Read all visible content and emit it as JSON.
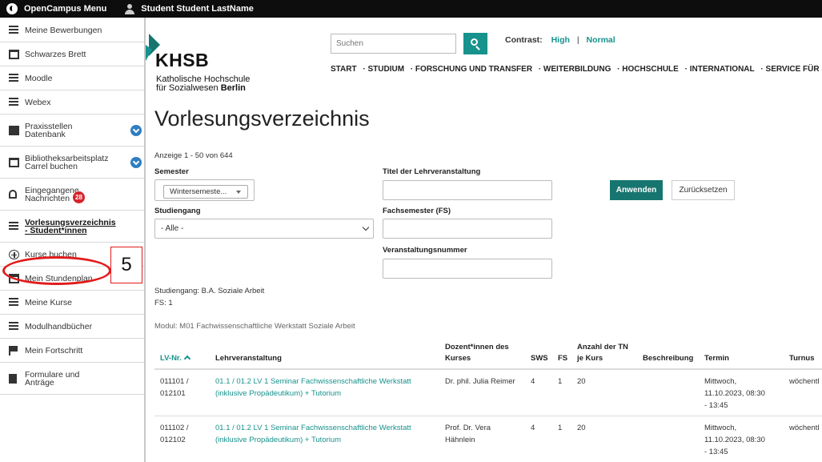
{
  "topbar": {
    "menu_label": "OpenCampus Menu",
    "user_label": "Student Student LastName"
  },
  "sidebar": {
    "items": [
      {
        "label": "Meine Bewerbungen",
        "icon": "list-icon"
      },
      {
        "label": "Schwarzes Brett",
        "icon": "board-icon"
      },
      {
        "label": "Moodle",
        "icon": "list-icon"
      },
      {
        "label": "Webex",
        "icon": "list-icon"
      },
      {
        "label": "Praxisstellen\nDatenbank",
        "icon": "building-icon",
        "expandable": true
      },
      {
        "label": "Bibliotheksarbeitsplatz\nCarrel buchen",
        "icon": "monitor-icon",
        "expandable": true
      },
      {
        "label": "Eingegangene\nNachrichten",
        "icon": "bell-icon",
        "badge": "28"
      },
      {
        "label": "Vorlesungsverzeichnis\n- Student*innen",
        "icon": "list-icon",
        "active": true
      },
      {
        "label": "Kurse buchen",
        "icon": "plus-circle-icon"
      },
      {
        "label": "Mein Stundenplan",
        "icon": "calendar-icon"
      },
      {
        "label": "Meine Kurse",
        "icon": "bulleted-list-icon"
      },
      {
        "label": "Modulhandbücher",
        "icon": "list-icon"
      },
      {
        "label": "Mein Fortschritt",
        "icon": "flag-icon"
      },
      {
        "label": "Formulare und\nAnträge",
        "icon": "document-icon"
      }
    ]
  },
  "annotation": {
    "step_number": "5",
    "color": "#e21b1b"
  },
  "header": {
    "logo_text": "KHSB",
    "logo_sub_line1": "Katholische Hochschule",
    "logo_sub_line2_a": "für Sozialwesen ",
    "logo_sub_line2_b": "Berlin",
    "search_placeholder": "Suchen",
    "contrast_label": "Contrast:",
    "contrast_high": "High",
    "contrast_sep": "|",
    "contrast_normal": "Normal",
    "nav": [
      "START",
      "· STUDIUM",
      "· FORSCHUNG UND TRANSFER",
      "· WEITERBILDUNG",
      "· HOCHSCHULE",
      "· INTERNATIONAL",
      "· SERVICE FÜR STUDIERE"
    ]
  },
  "page": {
    "title": "Vorlesungsverzeichnis",
    "count_text": "Anzeige 1 - 50 von 644"
  },
  "filters": {
    "semester_label": "Semester",
    "semester_value": "Wintersemeste...",
    "studiengang_label": "Studiengang",
    "studiengang_value": "- Alle -",
    "titel_label": "Titel der Lehrveranstaltung",
    "titel_value": "",
    "fachsemester_label": "Fachsemester (FS)",
    "fachsemester_value": "",
    "nummer_label": "Veranstaltungsnummer",
    "nummer_value": "",
    "apply_label": "Anwenden",
    "reset_label": "Zurücksetzen"
  },
  "summary": {
    "studiengang": "Studiengang: B.A. Soziale Arbeit",
    "fs": "FS: 1",
    "modul": "Modul: M01 Fachwissenschaftliche Werkstatt Soziale Arbeit"
  },
  "table": {
    "headers": {
      "lvnr": "LV-Nr.",
      "lehrveranstaltung": "Lehrveranstaltung",
      "dozent_1": "Dozent*innen des",
      "dozent_2": "Kurses",
      "sws": "SWS",
      "fs": "FS",
      "tn_1": "Anzahl der TN",
      "tn_2": "je Kurs",
      "beschreibung": "Beschreibung",
      "termin": "Termin",
      "turnus": "Turnus"
    },
    "rows": [
      {
        "lvnr_1": "011101 /",
        "lvnr_2": "012101",
        "title_1": "01.1 / 01.2 LV 1 Seminar Fachwissenschaftliche Werkstatt",
        "title_2": "(inklusive Propädeutikum) + Tutorium",
        "dozent_1": "Dr. phil. Julia Reimer",
        "dozent_2": "",
        "sws": "4",
        "fs": "1",
        "tn": "20",
        "termin_1": "Mittwoch,",
        "termin_2": "11.10.2023, 08:30",
        "termin_3": "- 13:45",
        "turnus": "wöchentl"
      },
      {
        "lvnr_1": "011102 /",
        "lvnr_2": "012102",
        "title_1": "01.1 / 01.2 LV 1 Seminar Fachwissenschaftliche Werkstatt",
        "title_2": "(inklusive Propädeutikum) + Tutorium",
        "dozent_1": "Prof. Dr. Vera",
        "dozent_2": "Hähnlein",
        "sws": "4",
        "fs": "1",
        "tn": "20",
        "termin_1": "Mittwoch,",
        "termin_2": "11.10.2023, 08:30",
        "termin_3": "- 13:45",
        "turnus": "wöchentl"
      }
    ]
  },
  "colors": {
    "accent": "#17928d",
    "apply_button": "#17756f",
    "badge": "#d6232a",
    "topbar": "#0d0d0d"
  }
}
